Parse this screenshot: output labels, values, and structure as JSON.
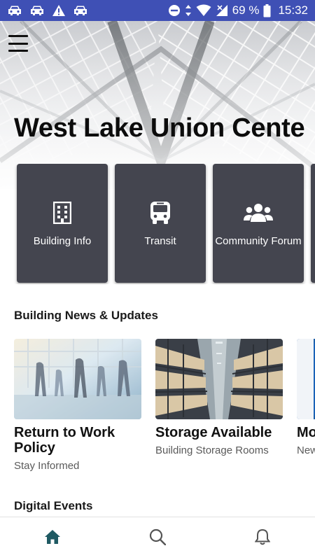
{
  "status_bar": {
    "battery_percent": "69 %",
    "time": "15:32",
    "left_icons": [
      "car-icon",
      "car-icon",
      "warning-icon",
      "car-icon"
    ],
    "right_icons": [
      "do-not-disturb-icon",
      "data-arrows-icon",
      "wifi-icon",
      "signal-icon",
      "battery-icon"
    ]
  },
  "header": {
    "title": "West Lake Union Center",
    "menu_icon": "menu-icon"
  },
  "quick_links": [
    {
      "label": "Building Info",
      "icon": "building-icon"
    },
    {
      "label": "Transit",
      "icon": "bus-icon"
    },
    {
      "label": "Community Forum",
      "icon": "people-icon"
    },
    {
      "label": "",
      "icon": ""
    }
  ],
  "news_section": {
    "title": "Building News & Updates",
    "items": [
      {
        "title": "Return to Work Policy",
        "subtitle": "Stay Informed"
      },
      {
        "title": "Storage Available",
        "subtitle": "Building Storage Rooms"
      },
      {
        "title": "Mo",
        "subtitle": "New"
      }
    ]
  },
  "events_section": {
    "title": "Digital Events"
  },
  "bottom_nav": {
    "items": [
      {
        "icon": "home-icon",
        "active": true
      },
      {
        "icon": "search-icon",
        "active": false
      },
      {
        "icon": "bell-icon",
        "active": false
      }
    ],
    "active_color": "#1f5a63",
    "inactive_color": "#555555"
  },
  "colors": {
    "status_bar": "#3f50b5",
    "tile": "#44454f"
  }
}
